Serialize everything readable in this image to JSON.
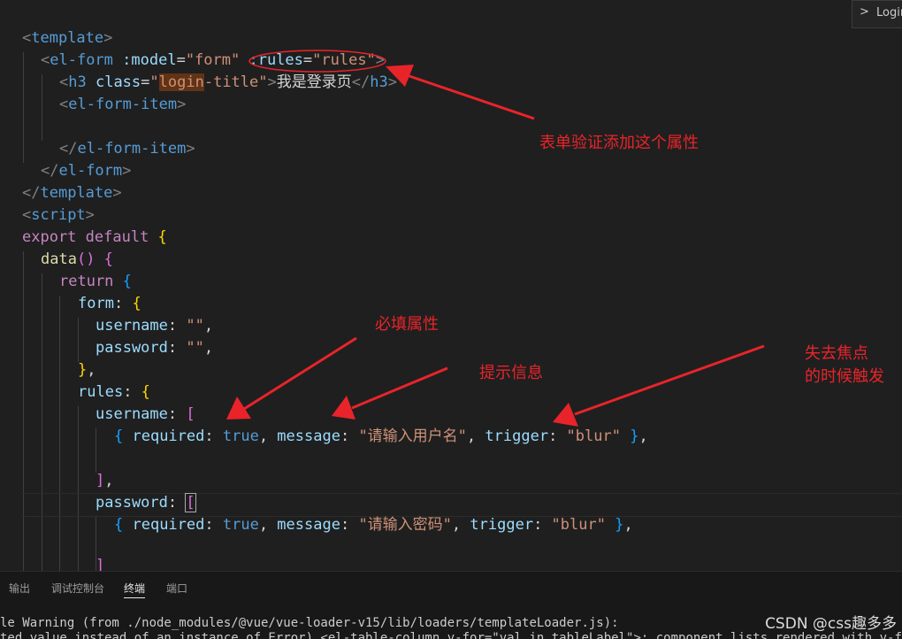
{
  "breadcrumb": {
    "chevron": ">",
    "label": "Login"
  },
  "code": {
    "l1": {
      "a": "<",
      "b": "template",
      "c": ">"
    },
    "l2": {
      "a": "<",
      "b": "el-form",
      "c": " :model",
      "d": "=",
      "e": "\"form\"",
      "f": " :rules",
      "g": "=",
      "h": "\"rules\"",
      "i": ">"
    },
    "l3": {
      "a": "<",
      "b": "h3",
      "c": " class",
      "d": "=",
      "e": "\"",
      "f": "login",
      "g": "-title\"",
      "h": ">",
      "i": "我是登录页",
      "j": "</",
      "k": "h3",
      "l": ">"
    },
    "l4": {
      "a": "<",
      "b": "el-form-item",
      "c": ">"
    },
    "l6": {
      "a": "</",
      "b": "el-form-item",
      "c": ">"
    },
    "l7": {
      "a": "</",
      "b": "el-form",
      "c": ">"
    },
    "l8": {
      "a": "</",
      "b": "template",
      "c": ">"
    },
    "l9": {
      "a": "<",
      "b": "script",
      "c": ">"
    },
    "l10": {
      "a": "export",
      "b": " default",
      "c": " {"
    },
    "l11": {
      "a": "data",
      "b": "()",
      "c": " {"
    },
    "l12": {
      "a": "return",
      "b": " {"
    },
    "l13": {
      "a": "form",
      "b": ": ",
      "c": "{"
    },
    "l14": {
      "a": "username",
      "b": ": ",
      "c": "\"\"",
      "d": ","
    },
    "l15": {
      "a": "password",
      "b": ": ",
      "c": "\"\"",
      "d": ","
    },
    "l16": {
      "a": "}",
      "b": ","
    },
    "l17": {
      "a": "rules",
      "b": ": ",
      "c": "{"
    },
    "l18": {
      "a": "username",
      "b": ": ",
      "c": "["
    },
    "l19": {
      "a": "{",
      "b": " required",
      "c": ": ",
      "d": "true",
      "e": ", ",
      "f": "message",
      "g": ": ",
      "h": "\"请输入用户名\"",
      "i": ", ",
      "j": "trigger",
      "k": ": ",
      "l": "\"blur\"",
      "m": " }",
      "n": ","
    },
    "l21": {
      "a": "]",
      "b": ","
    },
    "l22": {
      "a": "password",
      "b": ": ",
      "c": "["
    },
    "l23": {
      "a": "{",
      "b": " required",
      "c": ": ",
      "d": "true",
      "e": ", ",
      "f": "message",
      "g": ": ",
      "h": "\"请输入密码\"",
      "i": ", ",
      "j": "trigger",
      "k": ": ",
      "l": "\"blur\"",
      "m": " }",
      "n": ","
    },
    "l25": {
      "a": "]"
    }
  },
  "annotations": {
    "a1": "表单验证添加这个属性",
    "a2": "必填属性",
    "a3": "提示信息",
    "a4_line1": "失去焦点",
    "a4_line2": "的时候触发"
  },
  "panel": {
    "tabs": [
      "输出",
      "调试控制台",
      "终端",
      "端口"
    ],
    "active_tab": "终端",
    "terminal_line1": "le Warning (from ./node_modules/@vue/vue-loader-v15/lib/loaders/templateLoader.js):",
    "terminal_line2": "ted value instead of an instance of Error) <el-table-column v-for=\"val in tableLabel\">: component lists rendered with v-for sho"
  },
  "watermark": "CSDN @css趣多多",
  "colors": {
    "annotation": "#e8242a",
    "editor_bg": "#1f1f1f"
  }
}
